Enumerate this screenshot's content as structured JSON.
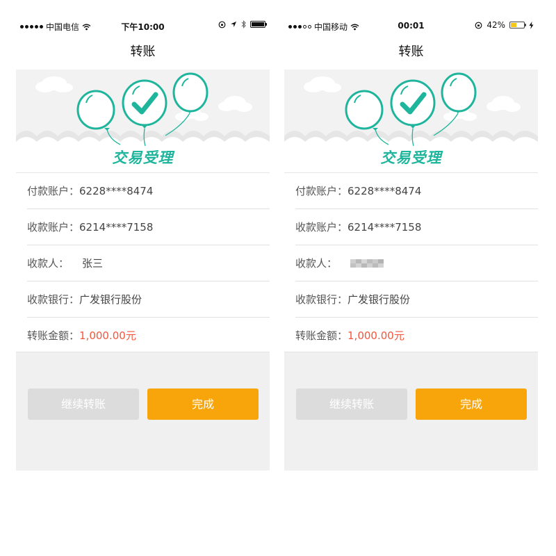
{
  "screens": [
    {
      "status": {
        "carrier": "中国电信",
        "time": "下午10:00",
        "battery_percent": "",
        "battery_level": 1.0,
        "signal_filled": 5,
        "signal_total": 5,
        "battery_color": "#111111"
      },
      "nav_title": "转账",
      "banner_title": "交易受理",
      "rows": [
        {
          "label": "付款账户：",
          "value": "6228****8474"
        },
        {
          "label": "收款账户：",
          "value": "6214****7158"
        },
        {
          "label": "收款人：",
          "value": "张三"
        },
        {
          "label": "收款银行：",
          "value": "广发银行股份"
        },
        {
          "label": "转账金额：",
          "value": "1,000.00元"
        }
      ],
      "buttons": {
        "continue": "继续转账",
        "done": "完成"
      }
    },
    {
      "status": {
        "carrier": "中国移动",
        "time": "00:01",
        "battery_percent": "42%",
        "battery_level": 0.42,
        "signal_filled": 3,
        "signal_total": 5,
        "battery_color": "#f5c518"
      },
      "nav_title": "转账",
      "banner_title": "交易受理",
      "rows": [
        {
          "label": "付款账户：",
          "value": "6228****8474"
        },
        {
          "label": "收款账户：",
          "value": "6214****7158"
        },
        {
          "label": "收款人：",
          "value": ""
        },
        {
          "label": "收款银行：",
          "value": "广发银行股份"
        },
        {
          "label": "转账金额：",
          "value": "1,000.00元"
        }
      ],
      "buttons": {
        "continue": "继续转账",
        "done": "完成"
      }
    }
  ],
  "colors": {
    "accent_teal": "#1fb59c",
    "amount_red": "#f2563c",
    "done_orange": "#f8a50b",
    "continue_gray": "#dcdcdc"
  },
  "icons": [
    "signal-dots-icon",
    "wifi-icon",
    "orientation-lock-icon",
    "location-arrow-icon",
    "bluetooth-icon",
    "battery-icon",
    "charging-bolt-icon",
    "balloon-icon",
    "checkmark-icon",
    "cloud-icon"
  ]
}
